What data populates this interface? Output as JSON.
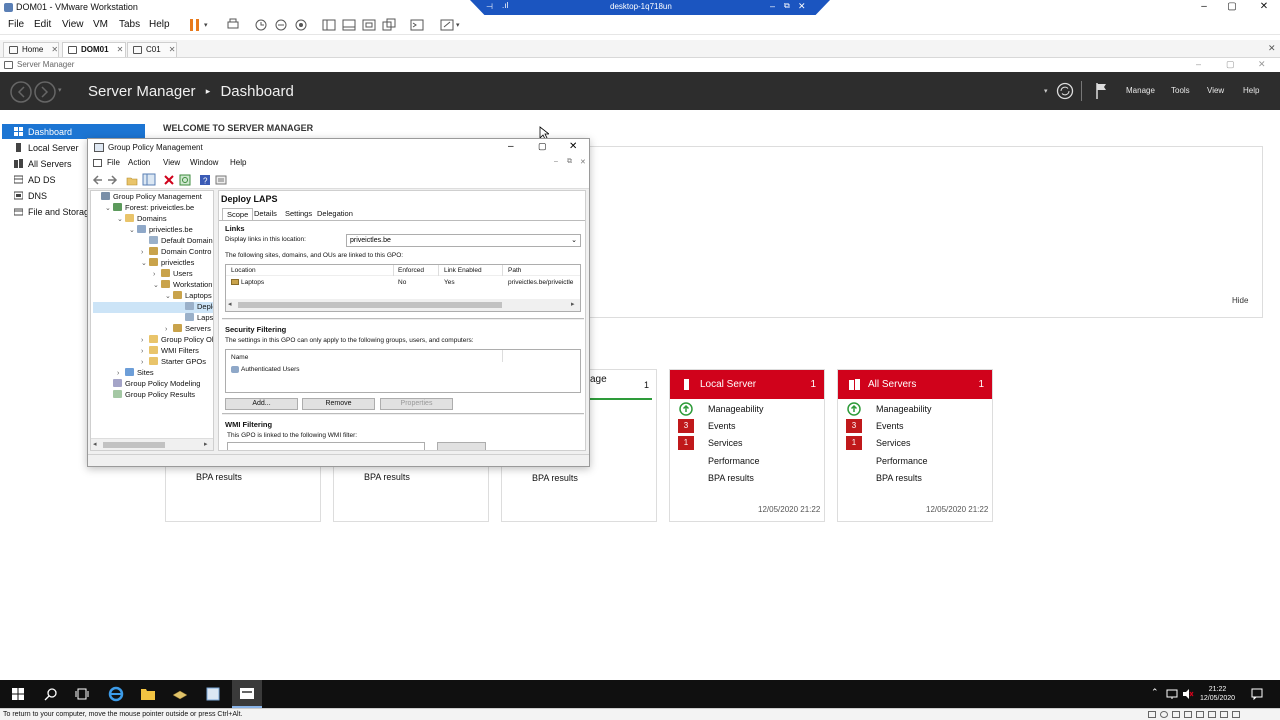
{
  "vmware": {
    "window_title": "DOM01 - VMware Workstation",
    "menu": [
      "File",
      "Edit",
      "View",
      "VM",
      "Tabs",
      "Help"
    ],
    "remote_host": "desktop-1q718un",
    "tabs": [
      {
        "label": "Home",
        "icon": "home-icon"
      },
      {
        "label": "DOM01",
        "icon": "vm-icon"
      },
      {
        "label": "C01",
        "icon": "vm-icon"
      }
    ],
    "status_text": "To return to your computer, move the mouse pointer outside or press Ctrl+Alt."
  },
  "server_manager": {
    "window_title": "Server Manager",
    "breadcrumb_root": "Server Manager",
    "breadcrumb_sep": "▸",
    "breadcrumb_page": "Dashboard",
    "header_menu": [
      "Manage",
      "Tools",
      "View",
      "Help"
    ],
    "sidebar": [
      {
        "label": "Dashboard"
      },
      {
        "label": "Local Server"
      },
      {
        "label": "All Servers"
      },
      {
        "label": "AD DS"
      },
      {
        "label": "DNS"
      },
      {
        "label": "File and Storag"
      }
    ],
    "welcome_title": "WELCOME TO SERVER MANAGER",
    "hide_label": "Hide",
    "partial_tile": {
      "head_fragment": "age",
      "count": "1"
    },
    "bpa_label": "BPA results",
    "tiles": [
      {
        "title": "Local Server",
        "count": "1",
        "rows": [
          {
            "label": "Manageability",
            "status": "ok",
            "badge": ""
          },
          {
            "label": "Events",
            "status": "error",
            "badge": "3"
          },
          {
            "label": "Services",
            "status": "error",
            "badge": "1"
          },
          {
            "label": "Performance",
            "status": "none",
            "badge": ""
          },
          {
            "label": "BPA results",
            "status": "none",
            "badge": ""
          }
        ],
        "timestamp": "12/05/2020 21:22"
      },
      {
        "title": "All Servers",
        "count": "1",
        "rows": [
          {
            "label": "Manageability",
            "status": "ok",
            "badge": ""
          },
          {
            "label": "Events",
            "status": "error",
            "badge": "3"
          },
          {
            "label": "Services",
            "status": "error",
            "badge": "1"
          },
          {
            "label": "Performance",
            "status": "none",
            "badge": ""
          },
          {
            "label": "BPA results",
            "status": "none",
            "badge": ""
          }
        ],
        "timestamp": "12/05/2020 21:22"
      }
    ]
  },
  "gpmc": {
    "title": "Group Policy Management",
    "menu": [
      "File",
      "Action",
      "View",
      "Window",
      "Help"
    ],
    "tree": [
      {
        "label": "Group Policy Management",
        "depth": 0,
        "twisty": "",
        "icon": "gpm"
      },
      {
        "label": "Forest: priveictles.be",
        "depth": 1,
        "twisty": "v",
        "icon": "forest"
      },
      {
        "label": "Domains",
        "depth": 2,
        "twisty": "v",
        "icon": "folder"
      },
      {
        "label": "priveictles.be",
        "depth": 3,
        "twisty": "v",
        "icon": "domain"
      },
      {
        "label": "Default Domain",
        "depth": 4,
        "twisty": "",
        "icon": "gpo"
      },
      {
        "label": "Domain Contro",
        "depth": 4,
        "twisty": ">",
        "icon": "ou"
      },
      {
        "label": "priveictles",
        "depth": 4,
        "twisty": "v",
        "icon": "ou"
      },
      {
        "label": "Users",
        "depth": 5,
        "twisty": ">",
        "icon": "ou"
      },
      {
        "label": "Workstation",
        "depth": 5,
        "twisty": "v",
        "icon": "ou"
      },
      {
        "label": "Laptops",
        "depth": 6,
        "twisty": "v",
        "icon": "ou"
      },
      {
        "label": "Deplo",
        "depth": 7,
        "twisty": "",
        "icon": "gpo",
        "selected": true
      },
      {
        "label": "Laps",
        "depth": 7,
        "twisty": "",
        "icon": "gpo"
      },
      {
        "label": "Servers",
        "depth": 6,
        "twisty": ">",
        "icon": "ou"
      },
      {
        "label": "Group Policy Ob",
        "depth": 4,
        "twisty": ">",
        "icon": "folder"
      },
      {
        "label": "WMI Filters",
        "depth": 4,
        "twisty": ">",
        "icon": "folder"
      },
      {
        "label": "Starter GPOs",
        "depth": 4,
        "twisty": ">",
        "icon": "folder"
      },
      {
        "label": "Sites",
        "depth": 2,
        "twisty": ">",
        "icon": "sites"
      },
      {
        "label": "Group Policy Modeling",
        "depth": 1,
        "twisty": "",
        "icon": "modeling"
      },
      {
        "label": "Group Policy Results",
        "depth": 1,
        "twisty": "",
        "icon": "results"
      }
    ],
    "gpo_title": "Deploy LAPS",
    "tabs": [
      "Scope",
      "Details",
      "Settings",
      "Delegation"
    ],
    "links_heading": "Links",
    "display_links_label": "Display links in this location:",
    "display_links_value": "priveictles.be",
    "linked_note": "The following sites, domains, and OUs are linked to this GPO:",
    "links_columns": [
      "Location",
      "Enforced",
      "Link Enabled",
      "Path"
    ],
    "links_rows": [
      {
        "location": "Laptops",
        "enforced": "No",
        "enabled": "Yes",
        "path": "priveictles.be/priveictle"
      }
    ],
    "security_heading": "Security Filtering",
    "security_note": "The settings in this GPO can only apply to the following groups, users, and computers:",
    "security_column": "Name",
    "security_rows": [
      "Authenticated Users"
    ],
    "buttons": {
      "add": "Add...",
      "remove": "Remove",
      "properties": "Properties"
    },
    "wmi_heading": "WMI Filtering",
    "wmi_note": "This GPO is linked to the following WMI filter:"
  },
  "taskbar": {
    "time": "21:22",
    "date": "12/05/2020"
  },
  "colors": {
    "accent_blue": "#1c75d3",
    "tile_red": "#d0021b",
    "header_dark": "#2d2d2d",
    "ok_green": "#2e9b3a"
  }
}
